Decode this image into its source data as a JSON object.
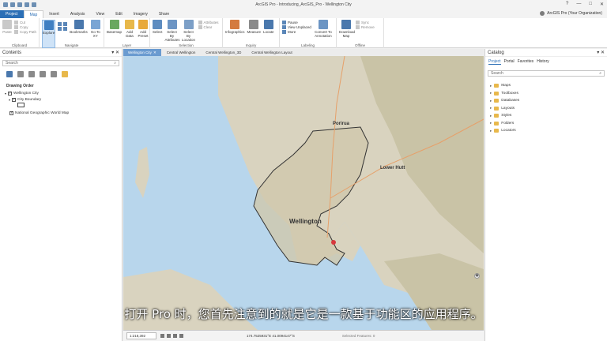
{
  "window": {
    "title": "ArcGIS Pro - Introducing_ArcGIS_Pro - Wellington City",
    "help": "?",
    "minimize": "—",
    "maximize": "□",
    "close": "✕"
  },
  "ribbon_tabs": [
    "Project",
    "Map",
    "Insert",
    "Analysis",
    "View",
    "Edit",
    "Imagery",
    "Share"
  ],
  "active_tab": "Map",
  "user": "ArcGIS Pro (Your Organization)",
  "ribbon": {
    "clipboard": {
      "label": "Clipboard",
      "paste": "Paste",
      "cut": "Cut",
      "copy": "Copy",
      "copy_path": "Copy Path"
    },
    "navigate": {
      "label": "Navigate",
      "explore": "Explore",
      "bookmarks": "Bookmarks",
      "goto": "Go To XY"
    },
    "layer": {
      "label": "Layer",
      "basemap": "Basemap",
      "add_data": "Add Data",
      "add_preset": "Add Preset"
    },
    "selection": {
      "label": "Selection",
      "select": "Select",
      "by_attributes": "Select By Attributes",
      "by_location": "Select By Location",
      "attributes": "Attributes",
      "clear": "Clear"
    },
    "inquiry": {
      "label": "Inquiry",
      "infographics": "Infographics",
      "measure": "Measure",
      "locate": "Locate"
    },
    "labeling": {
      "label": "Labeling",
      "pause": "Pause",
      "view_unplaced": "View Unplaced",
      "more": "More",
      "convert": "Convert To Annotation"
    },
    "offline": {
      "label": "Offline",
      "download": "Download Map",
      "sync": "Sync",
      "remove": "Remove"
    }
  },
  "contents": {
    "title": "Contents",
    "search_placeholder": "Search",
    "drawing_order": "Drawing Order",
    "layers": [
      "Wellington City",
      "City Boundary",
      "National Geographic World Map"
    ]
  },
  "view_tabs": [
    "Wellington City",
    "Central Wellington",
    "Central Wellington_3D",
    "Central Wellington Layout"
  ],
  "map": {
    "labels": {
      "porirua": "Porirua",
      "lower_hutt": "Lower Hutt",
      "wellington": "Wellington"
    },
    "colors": {
      "water": "#b8d6ec",
      "land": "#d9d3bf",
      "hills": "#c9c3a6",
      "boundary": "#333333"
    }
  },
  "subtitle": "打开 Pro 时，您首先注意到的就是它是一款基于功能区的应用程序。",
  "status": {
    "scale": "1:218,392",
    "coords": "174.7525931°E 41.0094147°S",
    "selected": "Selected Features: 0"
  },
  "catalog": {
    "title": "Catalog",
    "tabs": [
      "Project",
      "Portal",
      "Favorites",
      "History"
    ],
    "search_placeholder": "Search",
    "items": [
      "Maps",
      "Toolboxes",
      "Databases",
      "Layouts",
      "Styles",
      "Folders",
      "Locators"
    ]
  }
}
